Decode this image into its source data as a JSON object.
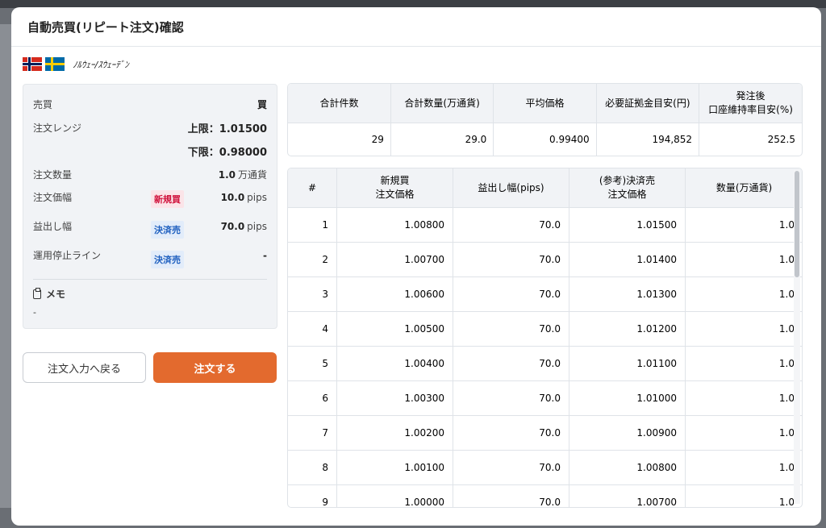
{
  "dialog": {
    "title": "自動売買(リピート注文)確認"
  },
  "pair": {
    "name": "ﾉﾙｳｪｰ/ｽｳｪｰﾃﾞﾝ",
    "flags": [
      "norway-flag-icon",
      "sweden-flag-icon"
    ]
  },
  "summary": {
    "side_label": "売買",
    "side_value": "買",
    "range_label": "注文レンジ",
    "range_upper": "上限：1.01500",
    "range_lower": "下限：0.98000",
    "qty_label": "注文数量",
    "qty_value": "1.0",
    "qty_unit": "万通貨",
    "width_label": "注文価幅",
    "width_badge": "新規買",
    "width_value": "10.0",
    "width_unit": "pips",
    "tp_label": "益出し幅",
    "tp_badge": "決済売",
    "tp_value": "70.0",
    "tp_unit": "pips",
    "stop_label": "運用停止ライン",
    "stop_badge": "決済売",
    "stop_value": "-",
    "memo_label": "メモ",
    "memo_value": "-"
  },
  "buttons": {
    "back": "注文入力へ戻る",
    "order": "注文する"
  },
  "stats": {
    "headers": [
      "合計件数",
      "合計数量(万通貨)",
      "平均価格",
      "必要証拠金目安(円)",
      "発注後\n口座維持率目安(%)"
    ],
    "values": [
      "29",
      "29.0",
      "0.99400",
      "194,852",
      "252.5"
    ]
  },
  "orders": {
    "headers": [
      "#",
      "新規買\n注文価格",
      "益出し幅(pips)",
      "(参考)決済売\n注文価格",
      "数量(万通貨)"
    ],
    "rows": [
      [
        "1",
        "1.00800",
        "70.0",
        "1.01500",
        "1.0"
      ],
      [
        "2",
        "1.00700",
        "70.0",
        "1.01400",
        "1.0"
      ],
      [
        "3",
        "1.00600",
        "70.0",
        "1.01300",
        "1.0"
      ],
      [
        "4",
        "1.00500",
        "70.0",
        "1.01200",
        "1.0"
      ],
      [
        "5",
        "1.00400",
        "70.0",
        "1.01100",
        "1.0"
      ],
      [
        "6",
        "1.00300",
        "70.0",
        "1.01000",
        "1.0"
      ],
      [
        "7",
        "1.00200",
        "70.0",
        "1.00900",
        "1.0"
      ],
      [
        "8",
        "1.00100",
        "70.0",
        "1.00800",
        "1.0"
      ],
      [
        "9",
        "1.00000",
        "70.0",
        "1.00700",
        "1.0"
      ]
    ]
  },
  "colors": {
    "accent": "#e36a2e",
    "buy": "#d0103a",
    "settle": "#1e5fbf"
  }
}
